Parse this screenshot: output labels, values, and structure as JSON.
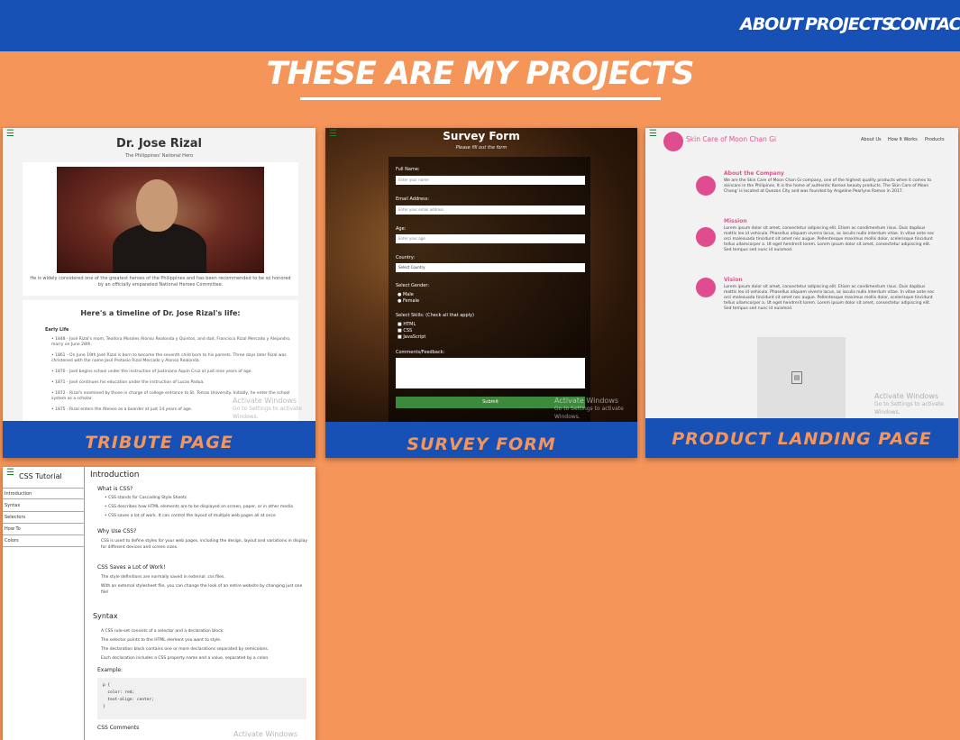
{
  "nav": {
    "about": "About",
    "projects": "Projects",
    "contact": "Contact"
  },
  "heading": "These are my projects",
  "colors": {
    "background": "#f5955a",
    "navbar": "#1751b5",
    "card_label": "#f5955a"
  },
  "projects": [
    {
      "label": "Tribute Page",
      "preview": {
        "name": "Dr. Jose Rizal",
        "subtitle": "The Philippines' National Hero",
        "caption": "He is widely considered one of the greatest heroes of the Philippines and has been recommended to be so honored by an officially empaneled National Heroes Committee.",
        "timeline_title": "Here's a timeline of Dr. Jose Rizal's life:",
        "timeline_section": "Early Life",
        "timeline": [
          "1848 - José Rizal's mom, Teodora Morales Alonso Realonda y Quintos, and dad, Francisco Rizal Mercado y Alejandro, marry on June 28th.",
          "1861 - On June 19th José Rizal is born to become the seventh child born to his parents. Three days later Rizal was christened with the name José Protasio Rizal Mercado y Alonso Realonda.",
          "1870 - José begins school under the instruction of Justiniano Aquin Cruz at just nine years of age.",
          "1871 - José continues his education under the instruction of Lucas Padua.",
          "1872 - Rizal's examined by those in charge of college entrance to St. Tomas University. Initially, he enter the school system as a scholar.",
          "1875 - Rizal enters the Ateneo as a boarder at just 14 years of age."
        ],
        "watermark_title": "Activate Windows",
        "watermark_sub": "Go to Settings to activate Windows."
      }
    },
    {
      "label": "Survey Form",
      "preview": {
        "title": "Survey Form",
        "description": "Please fill out the form",
        "full_name_label": "Full Name:",
        "full_name_placeholder": "Enter your name",
        "email_label": "Email Address:",
        "email_placeholder": "Enter your email address",
        "age_label": "Age:",
        "age_placeholder": "Enter your age",
        "country_label": "Country:",
        "country_value": "Select Country",
        "gender_label": "Select Gender:",
        "gender_options": [
          "Male",
          "Female"
        ],
        "skills_label": "Select Skills: (Check all that apply)",
        "skills": [
          "HTML",
          "CSS",
          "JavaScript"
        ],
        "comments_label": "Comments/Feedback:",
        "submit": "Submit",
        "watermark_title": "Activate Windows",
        "watermark_sub": "Go to Settings to activate Windows."
      }
    },
    {
      "label": "Product Landing Page",
      "preview": {
        "brand": "Skin Care of Moon Chan Gi",
        "nav": [
          "About Us",
          "How It Works",
          "Products"
        ],
        "features": [
          {
            "title": "About the Company",
            "text": "We are the Skin Care of Moon Chan Gi company, one of the highest quality products when it comes to skincare in the Philipines. It is the home of authentic Korean beauty products. The Skin Care of Moon Chang' is located at Quezon City and was founded by Angeline Pearlyne Ramos in 2017."
          },
          {
            "title": "Mission",
            "text": "Lorem ipsum dolor sit amet, consectetur adipiscing elit. Etiam ac condimentum risus. Duis dapibus mattis leo id vehicula. Phasellus aliquam viverra lacus, ac iaculis nulla interdum vitae. In vitae ante nec orci malesuada tincidunt sit amet nec augue. Pellentesque maximus mollis dolor, scelerisque tincidunt tellus ullamcorper a. Ut eget hendrerit lorem. Lorem ipsum dolor sit amet, consectetur adipiscing elit. Sed tempus sed nunc id euismod."
          },
          {
            "title": "Vision",
            "text": "Lorem ipsum dolor sit amet, consectetur adipiscing elit. Etiam ac condimentum risus. Duis dapibus mattis leo id vehicula. Phasellus aliquam viverra lacus, ac iaculis nulla interdum vitae. In vitae ante nec orci malesuada tincidunt sit amet nec augue. Pellentesque maximus mollis dolor, scelerisque tincidunt tellus ullamcorper a. Ut eget hendrerit lorem. Lorem ipsum dolor sit amet, consectetur adipiscing elit. Sed tempus sed nunc id euismod."
          }
        ],
        "watermark_title": "Activate Windows",
        "watermark_sub": "Go to Settings to activate Windows."
      }
    },
    {
      "label": "CSS Tutorial",
      "preview": {
        "sidebar_title": "CSS Tutorial",
        "sidebar_links": [
          "Introduction",
          "Syntax",
          "Selectors",
          "How To",
          "Colors"
        ],
        "intro_title": "Introduction",
        "what_title": "What is CSS?",
        "what_list": [
          "CSS stands for Cascading Style Sheets",
          "CSS describes how HTML elements are to be displayed on screen, paper, or in other media",
          "CSS saves a lot of work. It can control the layout of multiple web pages all at once"
        ],
        "why_title": "Why Use CSS?",
        "why_text": "CSS is used to define styles for your web pages, including the design, layout and variations in display for different devices and screen sizes.",
        "saves_title": "CSS Saves a Lot of Work!",
        "saves_text_1": "The style definitions are normally saved in external .css files.",
        "saves_text_2": "With an external stylesheet file, you can change the look of an entire website by changing just one file!",
        "syntax_title": "Syntax",
        "syntax_lines": [
          "A CSS rule-set consists of a selector and a declaration block:",
          "The selector points to the HTML element you want to style.",
          "The declaration block contains one or more declarations separated by semicolons.",
          "Each declaration includes a CSS property name and a value, separated by a colon."
        ],
        "example_title": "Example:",
        "example_code": "p {\n  color: red;\n  text-align: center;\n}",
        "comments_title": "CSS Comments",
        "watermark_title": "Activate Windows"
      }
    }
  ]
}
